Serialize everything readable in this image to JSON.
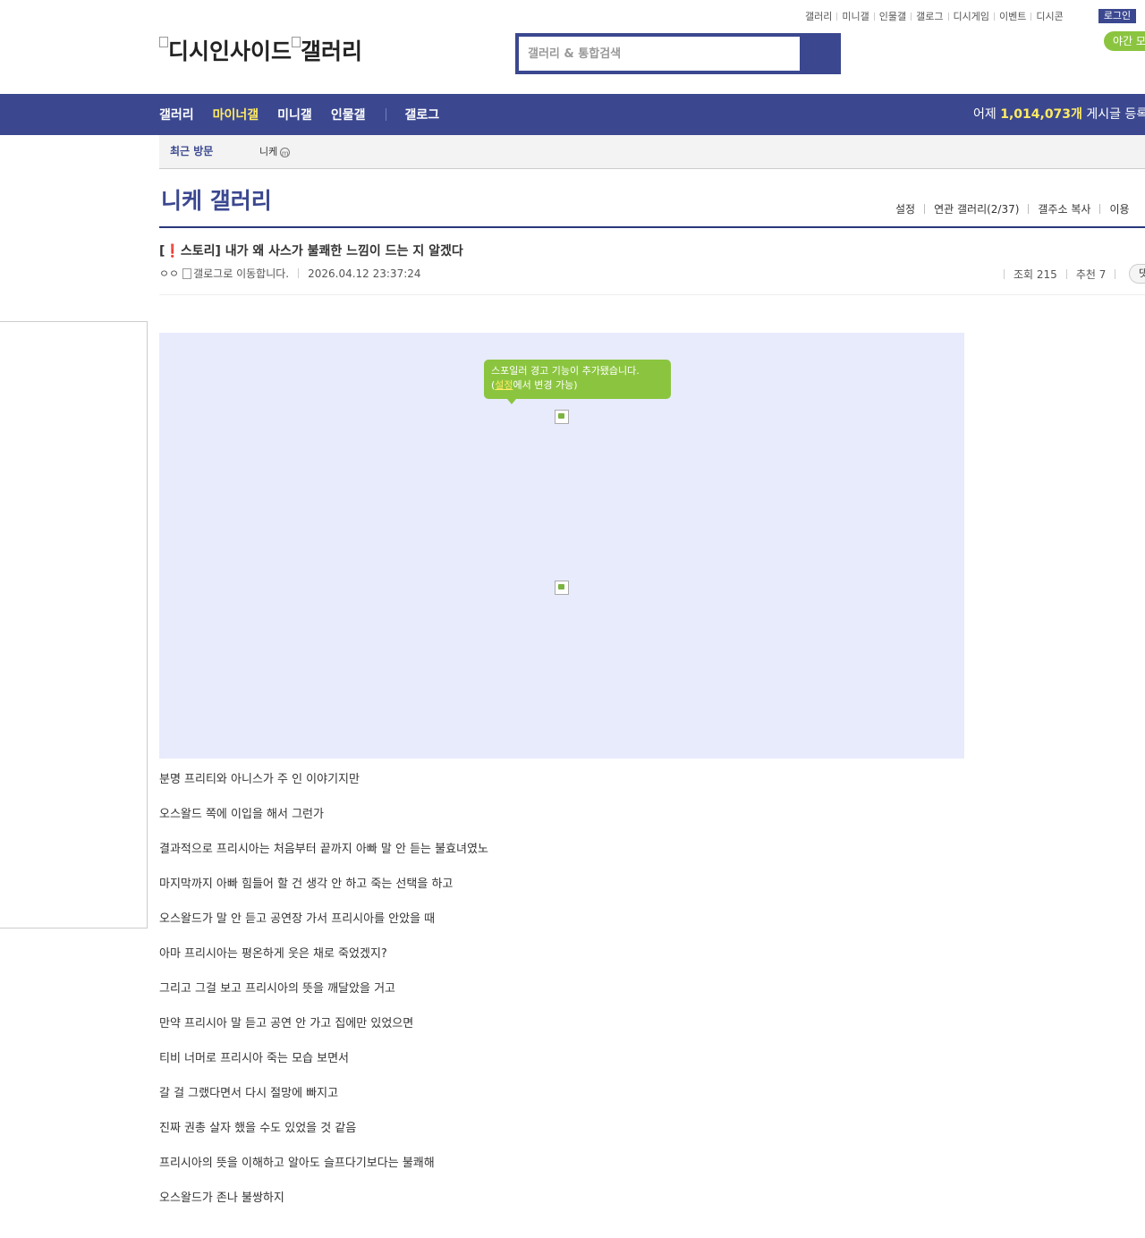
{
  "util_nav": [
    "갤러리",
    "미니갤",
    "인물갤",
    "갤로그",
    "디시게임",
    "이벤트",
    "디시콘"
  ],
  "login_label": "로그인",
  "night_mode_label": "야간 모",
  "logo": {
    "alt1": "디시인사이드",
    "alt2": "갤러리"
  },
  "search": {
    "placeholder": "갤러리 & 통합검색"
  },
  "gnb": {
    "items": [
      "갤러리",
      "마이너갤",
      "미니갤",
      "인물갤",
      "갤로그"
    ],
    "count_prefix": "어제",
    "count_value": "1,014,073개",
    "count_suffix": "게시글 등록"
  },
  "recent": {
    "label": "최근 방문",
    "item": "니케",
    "badge": "m"
  },
  "gallery": {
    "title": "니케 갤러리",
    "menu": [
      "설정",
      "연관 갤러리(2/37)",
      "갤주소 복사",
      "이용"
    ]
  },
  "post": {
    "title_prefix": "[",
    "title_mark": "❗",
    "title_text": "스토리] 내가 왜 사스가 불쾌한 느낌이 드는 지 알겠다",
    "nick": "ㅇㅇ",
    "gallog_alt": "갤로그로 이동합니다.",
    "datetime": "2026.04.12 23:37:24",
    "views_label": "조회 215",
    "recommend_label": "추천 7",
    "comment_label": "댓"
  },
  "spoiler": {
    "line1": "스포일러 경고 기능이 추가됐습니다.",
    "line2_open": "(",
    "line2_link": "설정",
    "line2_rest": "에서 변경 가능)"
  },
  "body_lines": [
    "분명 프리티와 아니스가 주 인 이야기지만",
    "오스왈드 쪽에 이입을 해서 그런가",
    "결과적으로 프리시아는 처음부터 끝까지 아빠 말 안 듣는 불효녀였노",
    "마지막까지 아빠 힘들어 할 건 생각 안 하고 죽는 선택을 하고",
    "오스왈드가 말 안 듣고 공연장 가서 프리시아를 안았을 때",
    "아마 프리시아는 평온하게 웃은 채로 죽었겠지?",
    "그리고 그걸 보고 프리시아의 뜻을 깨달았을 거고",
    "만약 프리시아 말 듣고 공연 안 가고 집에만 있었으면",
    "티비 너머로 프리시아 죽는 모습 보면서",
    "갈 걸 그랬다면서 다시 절망에 빠지고",
    "진짜 권총 살자 했을 수도 있었을 것 같음",
    "프리시아의 뜻을 이해하고 알아도 슬프다기보다는 불쾌해",
    "오스왈드가 존나 불쌍하지"
  ],
  "colors": {
    "brand": "#3b4890",
    "accent_yellow": "#ffeb63",
    "green": "#8bc53f",
    "spoiler_bg": "#e8ebfc"
  }
}
